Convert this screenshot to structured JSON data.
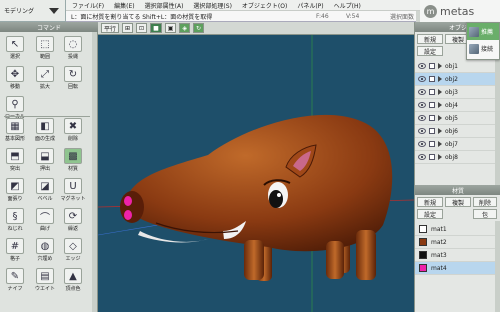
{
  "app": {
    "mode_label": "モデリング",
    "logo_text": "metas"
  },
  "menu": [
    "ファイル(F)",
    "編集(E)",
    "選択部属性(A)",
    "選択部処理(S)",
    "オブジェクト(O)",
    "パネル(P)",
    "ヘルプ(H)"
  ],
  "status": {
    "hint": "L：面に材質を割り当てる  Shift+L：面の材質を取得",
    "frame": "F:46",
    "vertex": "V:54",
    "selection": "選択面数"
  },
  "command_panel": {
    "title": "コマンド",
    "tools": [
      {
        "label": "選択",
        "icon": "select-arrow-icon",
        "glyph": "↖"
      },
      {
        "label": "範囲",
        "icon": "range-select-icon",
        "glyph": "⬚"
      },
      {
        "label": "投縄",
        "icon": "lasso-icon",
        "glyph": "◌"
      },
      {
        "label": "移動",
        "icon": "move-icon",
        "glyph": "✥"
      },
      {
        "label": "拡大",
        "icon": "scale-icon",
        "glyph": "⤢"
      },
      {
        "label": "回転",
        "icon": "rotate-icon",
        "glyph": "↻"
      },
      {
        "label": "ローカル",
        "icon": "local-icon",
        "glyph": "⚲"
      },
      {
        "label": "基本図形",
        "icon": "primitive-icon",
        "glyph": "▦"
      },
      {
        "label": "面の生成",
        "icon": "face-create-icon",
        "glyph": "◧"
      },
      {
        "label": "削除",
        "icon": "delete-icon",
        "glyph": "✖"
      },
      {
        "label": "突出",
        "icon": "extrude-icon",
        "glyph": "⬒"
      },
      {
        "label": "押出",
        "icon": "push-icon",
        "glyph": "⬓"
      },
      {
        "label": "材質",
        "icon": "material-icon",
        "glyph": "▩"
      },
      {
        "label": "面張り",
        "icon": "face-fill-icon",
        "glyph": "◩"
      },
      {
        "label": "ベベル",
        "icon": "bevel-icon",
        "glyph": "◪"
      },
      {
        "label": "マグネット",
        "icon": "magnet-icon",
        "glyph": "U"
      },
      {
        "label": "ねじれ",
        "icon": "twist-icon",
        "glyph": "§"
      },
      {
        "label": "曲げ",
        "icon": "bend-icon",
        "glyph": "⌒"
      },
      {
        "label": "繰返",
        "icon": "repeat-icon",
        "glyph": "⟳"
      },
      {
        "label": "格子",
        "icon": "lattice-icon",
        "glyph": "#"
      },
      {
        "label": "穴埋め",
        "icon": "fill-hole-icon",
        "glyph": "◍"
      },
      {
        "label": "エッジ",
        "icon": "edge-icon",
        "glyph": "◇"
      },
      {
        "label": "ナイフ",
        "icon": "knife-icon",
        "glyph": "✎"
      },
      {
        "label": "ウエイト",
        "icon": "weight-icon",
        "glyph": "▤"
      },
      {
        "label": "頂点色",
        "icon": "vertex-color-icon",
        "glyph": "▲"
      }
    ]
  },
  "view_toolbar": {
    "mode": "平行"
  },
  "object_panel": {
    "title": "オブジ",
    "buttons": [
      "新規",
      "複製",
      "設定"
    ],
    "objects": [
      "obj1",
      "obj2",
      "obj3",
      "obj4",
      "obj5",
      "obj6",
      "obj7",
      "obj8"
    ],
    "selected_index": 1,
    "popup": [
      "推薦",
      "接続"
    ]
  },
  "material_panel": {
    "title": "材質",
    "buttons": [
      "新規",
      "複製",
      "削除",
      "設定",
      "包"
    ],
    "materials": [
      {
        "name": "mat1",
        "color": "#ffffff"
      },
      {
        "name": "mat2",
        "color": "#8a3a12"
      },
      {
        "name": "mat3",
        "color": "#111111"
      },
      {
        "name": "mat4",
        "color": "#ee22aa"
      }
    ],
    "selected_index": 3
  },
  "colors": {
    "viewport_bg": "#1e4f6a",
    "body": "#8a3a12",
    "snout": "#ee22aa",
    "select": "#b8d6ee"
  }
}
